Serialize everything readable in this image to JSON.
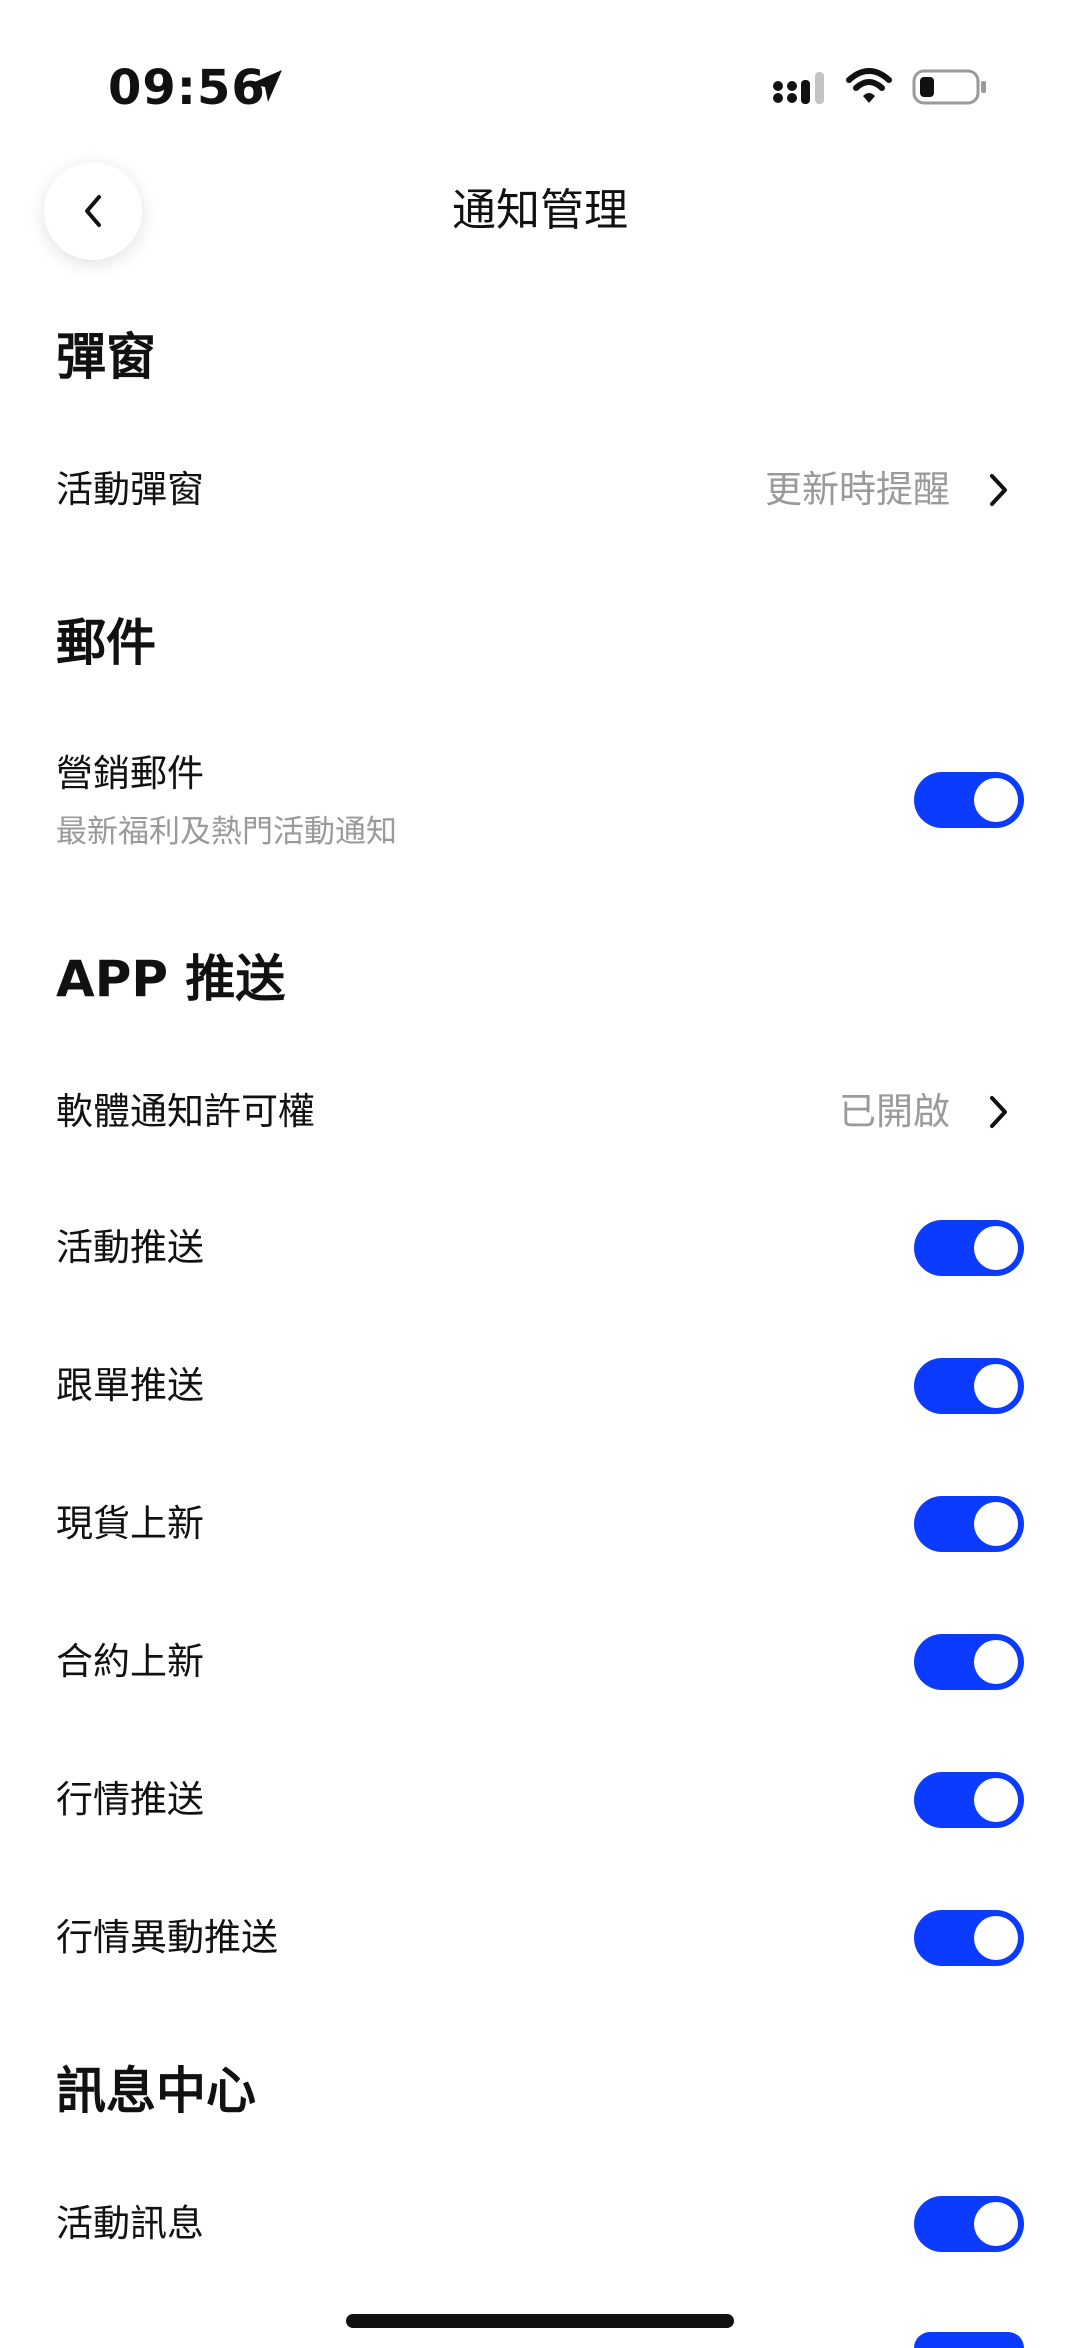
{
  "status_bar": {
    "time": "09:56"
  },
  "header": {
    "title": "通知管理"
  },
  "sections": {
    "popup": {
      "title": "彈窗",
      "rows": [
        {
          "label": "活動彈窗",
          "value": "更新時提醒"
        }
      ]
    },
    "mail": {
      "title": "郵件",
      "rows": [
        {
          "label": "營銷郵件",
          "sub": "最新福利及熱門活動通知",
          "on": true
        }
      ]
    },
    "app_push": {
      "title": "APP 推送",
      "rows": [
        {
          "label": "軟體通知許可權",
          "value": "已開啟"
        },
        {
          "label": "活動推送",
          "on": true
        },
        {
          "label": "跟單推送",
          "on": true
        },
        {
          "label": "現貨上新",
          "on": true
        },
        {
          "label": "合約上新",
          "on": true
        },
        {
          "label": "行情推送",
          "on": true
        },
        {
          "label": "行情異動推送",
          "on": true
        }
      ]
    },
    "message_center": {
      "title": "訊息中心",
      "rows": [
        {
          "label": "活動訊息",
          "on": true
        },
        {
          "on": true
        }
      ]
    }
  },
  "colors": {
    "accent": "#0a3bff",
    "secondary_text": "#9a9a9a"
  }
}
